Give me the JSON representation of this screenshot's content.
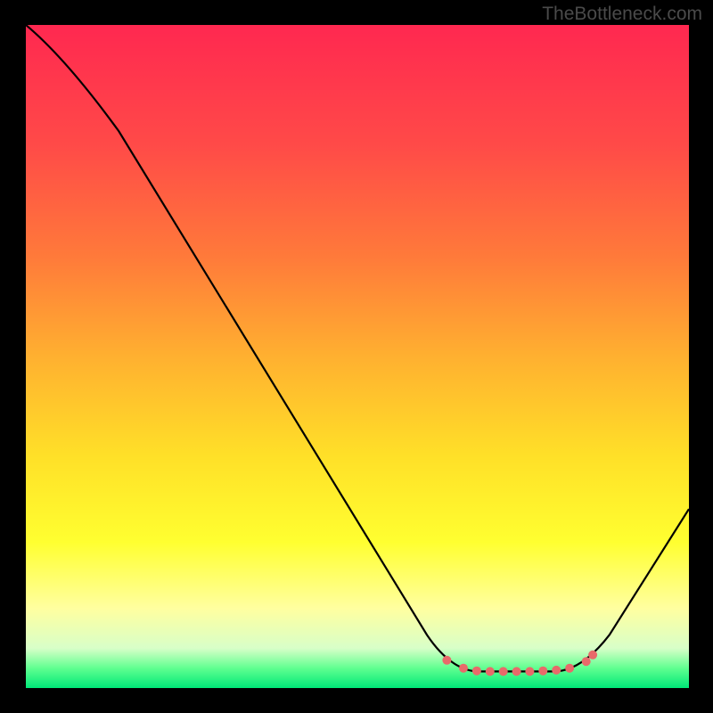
{
  "watermark": "TheBottleneck.com",
  "chart_data": {
    "type": "line",
    "title": "",
    "xlabel": "",
    "ylabel": "",
    "xlim": [
      0,
      100
    ],
    "ylim": [
      0,
      100
    ],
    "background_gradient": {
      "stops": [
        {
          "offset": 0,
          "color": "#ff2850"
        },
        {
          "offset": 18,
          "color": "#ff4a48"
        },
        {
          "offset": 35,
          "color": "#ff7a3a"
        },
        {
          "offset": 50,
          "color": "#ffb030"
        },
        {
          "offset": 65,
          "color": "#ffe028"
        },
        {
          "offset": 78,
          "color": "#ffff30"
        },
        {
          "offset": 88,
          "color": "#ffffa0"
        },
        {
          "offset": 94,
          "color": "#d8ffc8"
        },
        {
          "offset": 97,
          "color": "#60ff90"
        },
        {
          "offset": 100,
          "color": "#00e878"
        }
      ]
    },
    "series": [
      {
        "name": "curve",
        "color": "#000000",
        "points": [
          {
            "x": 0,
            "y": 100
          },
          {
            "x": 8,
            "y": 92
          },
          {
            "x": 14,
            "y": 84
          },
          {
            "x": 60.5,
            "y": 8
          },
          {
            "x": 64,
            "y": 3.5
          },
          {
            "x": 68,
            "y": 2.5
          },
          {
            "x": 80,
            "y": 2.5
          },
          {
            "x": 84,
            "y": 3.5
          },
          {
            "x": 88,
            "y": 8
          },
          {
            "x": 100,
            "y": 27
          }
        ]
      }
    ],
    "markers": {
      "name": "highlight-dots",
      "color": "#e86a6a",
      "points": [
        {
          "x": 63.5,
          "y": 4.2
        },
        {
          "x": 66,
          "y": 3.0
        },
        {
          "x": 68,
          "y": 2.6
        },
        {
          "x": 70,
          "y": 2.5
        },
        {
          "x": 72,
          "y": 2.5
        },
        {
          "x": 74,
          "y": 2.5
        },
        {
          "x": 76,
          "y": 2.5
        },
        {
          "x": 78,
          "y": 2.6
        },
        {
          "x": 80,
          "y": 2.7
        },
        {
          "x": 82,
          "y": 3.0
        },
        {
          "x": 84.5,
          "y": 4.0
        },
        {
          "x": 85.5,
          "y": 5.0
        }
      ]
    }
  }
}
